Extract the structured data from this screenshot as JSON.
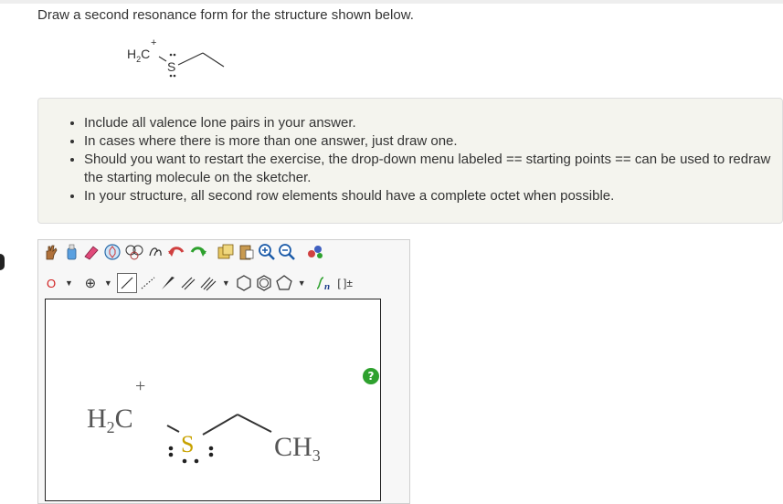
{
  "question": {
    "text": "Draw a second resonance form for the structure shown below."
  },
  "structure_small": {
    "carbon_label": "H2C",
    "charge": "+",
    "sulfur_label": "S"
  },
  "instructions": {
    "items": [
      "Include all valence lone pairs in your answer.",
      "In cases where there is more than one answer, just draw one.",
      "Should you want to restart the exercise, the drop-down menu labeled == starting points == can be used to redraw the starting molecule on the sketcher.",
      "In your structure, all second row elements should have a complete octet when possible."
    ]
  },
  "toolbar": {
    "element_selector": "O",
    "charge_label": "⊕",
    "template_label": "[ ]±",
    "sn_label": "Sn"
  },
  "canvas": {
    "help_label": "?",
    "carbon_label": "H2C",
    "charge": "+",
    "sulfur_label": "S",
    "methyl_label": "CH3"
  },
  "colors": {
    "sulfur": "#c8a200",
    "help": "#2ea12e",
    "instructions_bg": "#f4f4ee"
  }
}
